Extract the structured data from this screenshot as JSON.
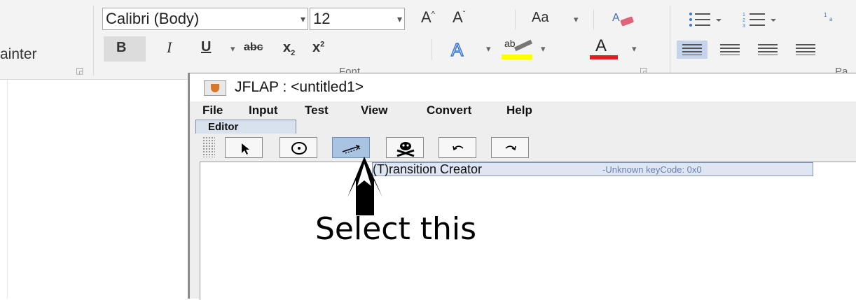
{
  "ribbon": {
    "clipboard": {
      "painter_label": "ainter",
      "launcher_icon": "dialog-launcher-icon"
    },
    "font": {
      "font_name": "Calibri (Body)",
      "font_size": "12",
      "grow_label": "A",
      "shrink_label": "A",
      "case_label": "Aa",
      "bold": "B",
      "italic": "I",
      "underline": "U",
      "strike": "abc",
      "subscript": "x",
      "sub_mark": "2",
      "superscript": "x",
      "sup_mark": "2",
      "highlight_label": "ab",
      "font_color_label": "A",
      "group_label": "Font",
      "highlight_color": "#ffff00",
      "font_color": "#e02020"
    },
    "paragraph": {
      "group_label": "Pa"
    }
  },
  "jflap": {
    "title": "JFLAP : <untitled1>",
    "menus": [
      "File",
      "Input",
      "Test",
      "View",
      "Convert",
      "Help"
    ],
    "tab_label": "Editor",
    "tools": [
      {
        "name": "attribute-editor",
        "icon": "pointer-arrow-icon",
        "selected": false
      },
      {
        "name": "state-creator",
        "icon": "state-circle-icon",
        "selected": false
      },
      {
        "name": "transition-creator",
        "icon": "transition-arrow-icon",
        "selected": true
      },
      {
        "name": "deleter",
        "icon": "skull-crossbones-icon",
        "selected": false
      },
      {
        "name": "undo",
        "icon": "undo-icon",
        "selected": false
      },
      {
        "name": "redo",
        "icon": "redo-icon",
        "selected": false
      }
    ],
    "tooltip": {
      "main": "(T)ransition Creator",
      "accelerator": "-Unknown keyCode: 0x0"
    }
  },
  "annotation": {
    "text": "Select this",
    "arrow_icon": "up-arrow-annotation-icon"
  }
}
